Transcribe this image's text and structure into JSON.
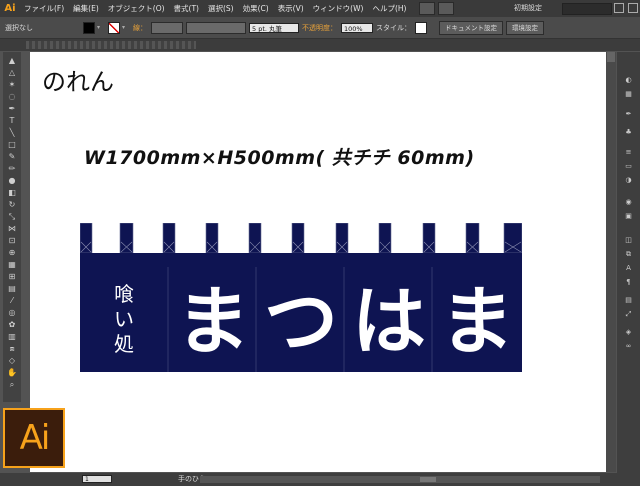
{
  "app": {
    "logo_text": "Ai",
    "menus": [
      "ファイル(F)",
      "編集(E)",
      "オブジェクト(O)",
      "書式(T)",
      "選択(S)",
      "効果(C)",
      "表示(V)",
      "ウィンドウ(W)",
      "ヘルプ(H)"
    ],
    "workspace_label": "初期設定",
    "brand_color": "#f7a21b"
  },
  "control_bar": {
    "selection_label": "選択なし",
    "stroke_label": "線：",
    "brush_label": "5 pt. 丸筆",
    "opacity_label": "不透明度：",
    "opacity_value": "100%",
    "style_label": "スタイル：",
    "document_setup_button": "ドキュメント設定",
    "preferences_button": "環境設定"
  },
  "canvas": {
    "title": "のれん",
    "size_spec": "W1700mm×H500mm( 共チチ 60mm)",
    "banner": {
      "color": "#0e1452",
      "small_text": "喰い処",
      "large_chars": [
        "ま",
        "つ",
        "は",
        "ま"
      ]
    }
  },
  "status_bar": {
    "zoom": "1",
    "tool_name": "手のひら"
  },
  "big_logo_text": "Ai"
}
